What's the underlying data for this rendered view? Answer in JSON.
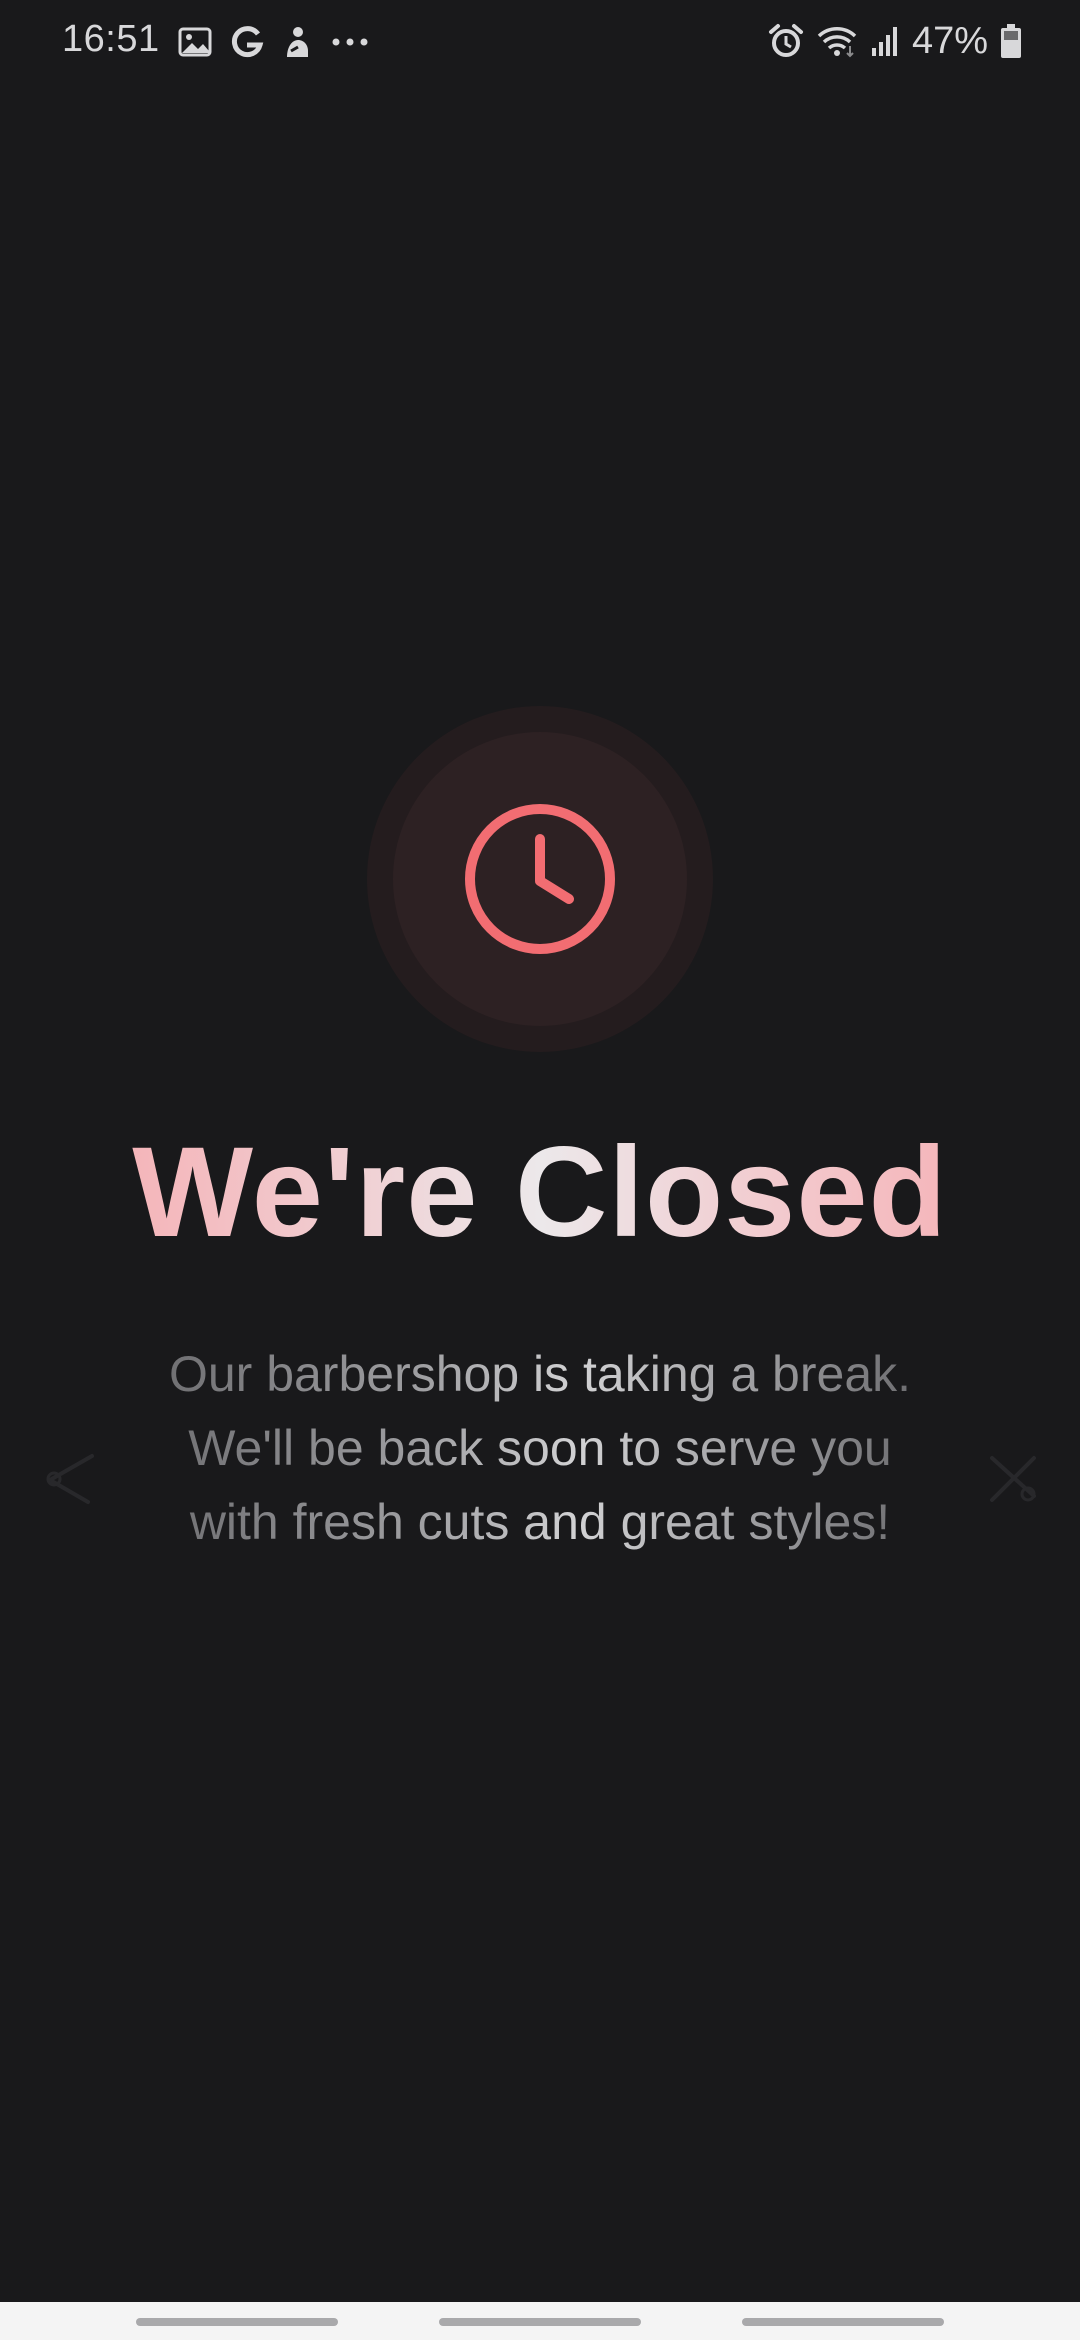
{
  "status_bar": {
    "time": "16:51",
    "left_icons": [
      "gallery-icon",
      "google-icon",
      "notification-app-icon",
      "more-notifications-icon"
    ],
    "right_icons": [
      "alarm-icon",
      "wifi-icon",
      "signal-icon",
      "battery-icon"
    ],
    "battery_percent": "47%"
  },
  "main": {
    "icon": "clock-icon",
    "title": "We're Closed",
    "message": "Our barbershop is taking a break. We'll be back soon to serve you with fresh cuts and great styles!"
  },
  "decor": {
    "left_icon": "scissors-icon",
    "right_icon": "scissors-icon"
  },
  "colors": {
    "background": "#19191b",
    "accent": "#f26d72",
    "badge": "#2d2123"
  },
  "nav_bar": {
    "items": [
      "recent-apps",
      "home",
      "back"
    ]
  }
}
